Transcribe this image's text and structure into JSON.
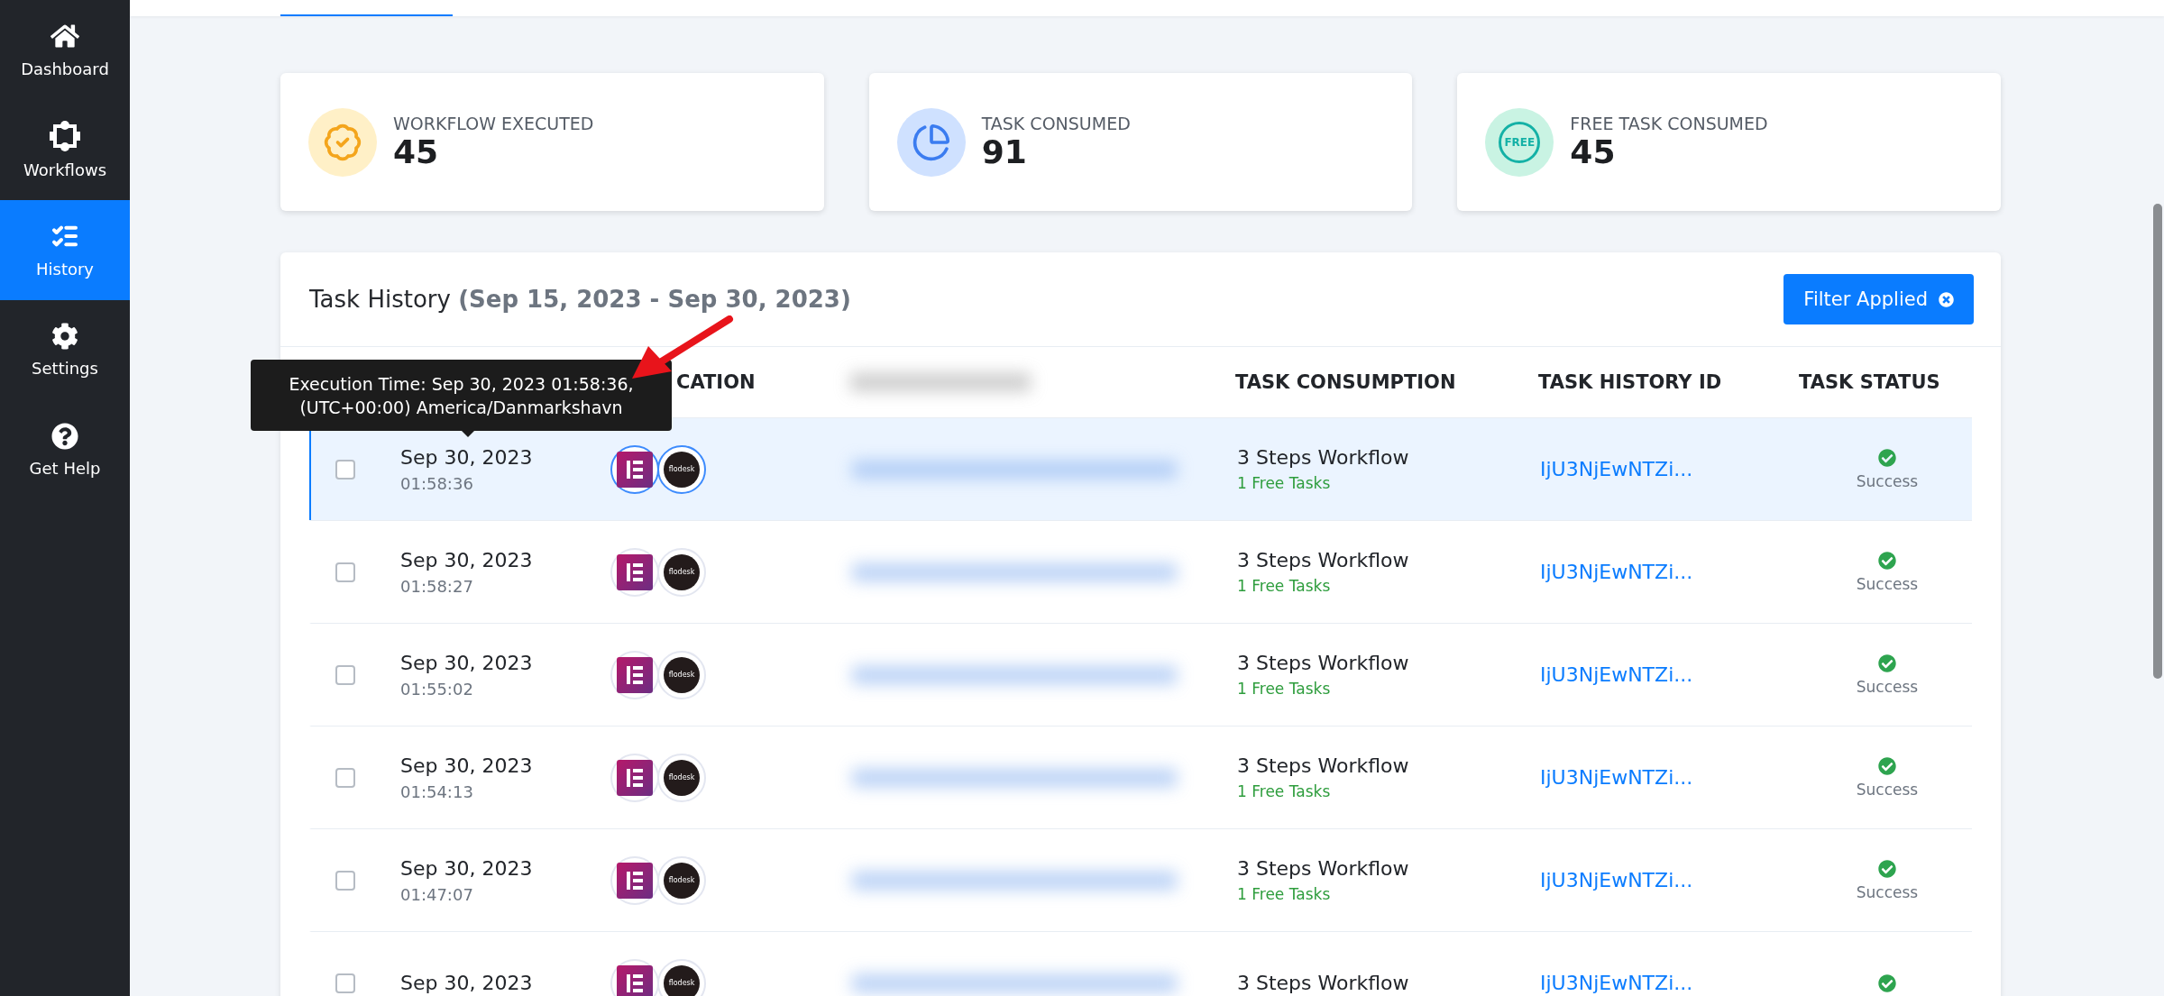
{
  "sidebar": {
    "items": [
      {
        "kind": "home",
        "label": "Dashboard",
        "selected": false
      },
      {
        "kind": "workflow",
        "label": "Workflows",
        "selected": false
      },
      {
        "kind": "history",
        "label": "History",
        "selected": true
      },
      {
        "kind": "settings",
        "label": "Settings",
        "selected": false
      },
      {
        "kind": "help",
        "label": "Get Help",
        "selected": false
      }
    ]
  },
  "stats": [
    {
      "kind": "badge",
      "label": "WORKFLOW EXECUTED",
      "value": "45"
    },
    {
      "kind": "pie",
      "label": "TASK CONSUMED",
      "value": "91"
    },
    {
      "kind": "free",
      "label": "FREE TASK CONSUMED",
      "value": "45",
      "icon_text": "FREE"
    }
  ],
  "task_history": {
    "title": "Task History",
    "range": "(Sep 15, 2023 - Sep 30, 2023)",
    "filter_button": "Filter Applied",
    "columns": [
      "CATION",
      "TASK CONSUMPTION",
      "TASK HISTORY ID",
      "TASK STATUS"
    ],
    "tooltip": {
      "line1": "Execution Time: Sep 30, 2023 01:58:36,",
      "line2": "(UTC+00:00) America/Danmarkshavn"
    },
    "rows": [
      {
        "selected": true,
        "checked": false,
        "date": "Sep 30, 2023",
        "time": "01:58:36",
        "app_label": "flodesk",
        "consumption": "3 Steps Workflow",
        "free": "1 Free Tasks",
        "id": "IjU3NjEwNTZi...",
        "status": "Success"
      },
      {
        "selected": false,
        "checked": false,
        "date": "Sep 30, 2023",
        "time": "01:58:27",
        "app_label": "flodesk",
        "consumption": "3 Steps Workflow",
        "free": "1 Free Tasks",
        "id": "IjU3NjEwNTZi...",
        "status": "Success"
      },
      {
        "selected": false,
        "checked": false,
        "date": "Sep 30, 2023",
        "time": "01:55:02",
        "app_label": "flodesk",
        "consumption": "3 Steps Workflow",
        "free": "1 Free Tasks",
        "id": "IjU3NjEwNTZi...",
        "status": "Success"
      },
      {
        "selected": false,
        "checked": false,
        "date": "Sep 30, 2023",
        "time": "01:54:13",
        "app_label": "flodesk",
        "consumption": "3 Steps Workflow",
        "free": "1 Free Tasks",
        "id": "IjU3NjEwNTZi...",
        "status": "Success"
      },
      {
        "selected": false,
        "checked": false,
        "date": "Sep 30, 2023",
        "time": "01:47:07",
        "app_label": "flodesk",
        "consumption": "3 Steps Workflow",
        "free": "1 Free Tasks",
        "id": "IjU3NjEwNTZi...",
        "status": "Success"
      },
      {
        "selected": false,
        "checked": false,
        "date": "Sep 30, 2023",
        "app_label": "flodesk",
        "consumption": "3 Steps Workflow",
        "id": "IjU3NjEwNTZi..."
      }
    ]
  }
}
